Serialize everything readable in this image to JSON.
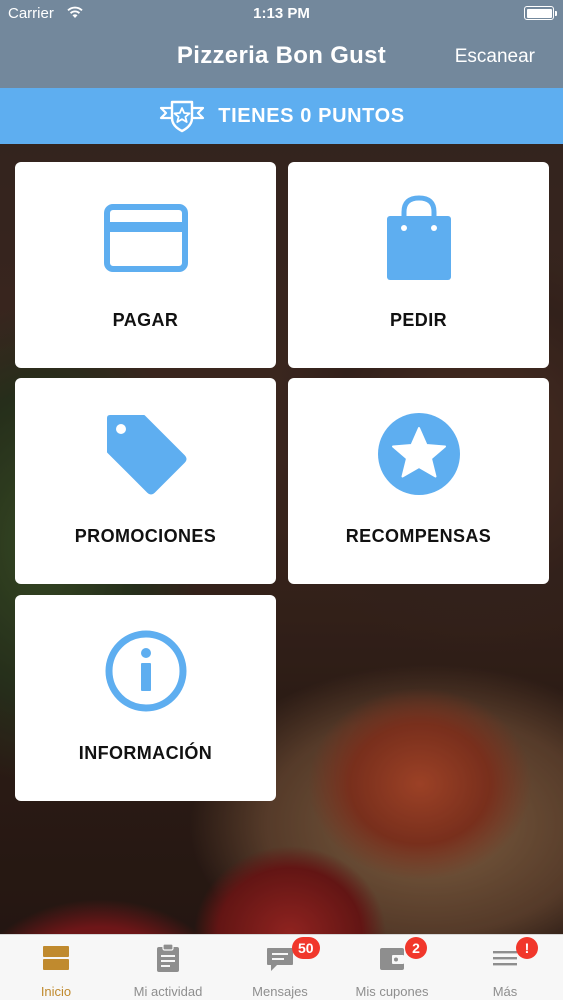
{
  "status_bar": {
    "carrier": "Carrier",
    "time": "1:13 PM"
  },
  "nav": {
    "title": "Pizzeria Bon Gust",
    "action": "Escanear"
  },
  "points": {
    "label": "TIENES 0 PUNTOS"
  },
  "tiles": [
    {
      "label": "PAGAR",
      "icon": "credit-card-icon"
    },
    {
      "label": "PEDIR",
      "icon": "shopping-bag-icon"
    },
    {
      "label": "PROMOCIONES",
      "icon": "tag-icon"
    },
    {
      "label": "RECOMPENSAS",
      "icon": "star-icon"
    },
    {
      "label": "INFORMACIÓN",
      "icon": "info-icon"
    }
  ],
  "tabs": [
    {
      "label": "Inicio",
      "icon": "home-icon",
      "active": true
    },
    {
      "label": "Mi actividad",
      "icon": "clipboard-icon"
    },
    {
      "label": "Mensajes",
      "icon": "chat-icon",
      "badge": "50"
    },
    {
      "label": "Mis cupones",
      "icon": "wallet-icon",
      "badge": "2"
    },
    {
      "label": "Más",
      "icon": "menu-icon",
      "badge": "!"
    }
  ],
  "colors": {
    "accent": "#5eaef0",
    "nav": "#73889c",
    "active_tab": "#c08a2e",
    "badge": "#f1372b"
  }
}
